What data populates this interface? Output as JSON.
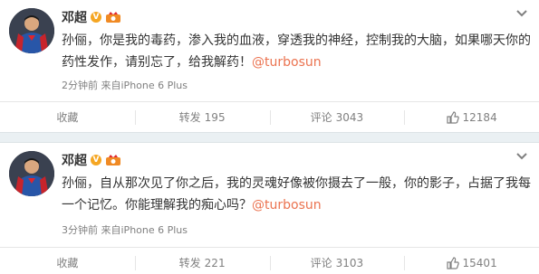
{
  "posts": [
    {
      "author": "邓超",
      "verified_icon": "verified-badge-icon",
      "member_icon": "crown-icon",
      "text_before": "孙俪，你是我的毒药，渗入我的血液，穿透我的神经，控制我的大脑，如果哪天你的药性发作，请别忘了，给我解药！",
      "mention": "@turbosun",
      "time": "2分钟前",
      "source": "来自iPhone 6 Plus",
      "actions": {
        "favorite_label": "收藏",
        "repost_label": "转发",
        "repost_count": "195",
        "comment_label": "评论",
        "comment_count": "3043",
        "like_count": "12184"
      }
    },
    {
      "author": "邓超",
      "verified_icon": "verified-badge-icon",
      "member_icon": "crown-icon",
      "text_before": "孙俪，自从那次见了你之后，我的灵魂好像被你摄去了一般，你的影子，占据了我每一个记忆。你能理解我的痴心吗？",
      "mention": "@turbosun",
      "time": "3分钟前",
      "source": "来自iPhone 6 Plus",
      "actions": {
        "favorite_label": "收藏",
        "repost_label": "转发",
        "repost_count": "221",
        "comment_label": "评论",
        "comment_count": "3103",
        "like_count": "15401"
      }
    }
  ],
  "colors": {
    "mention": "#eb7350",
    "meta": "#808080",
    "separator": "#eaf0f3"
  }
}
